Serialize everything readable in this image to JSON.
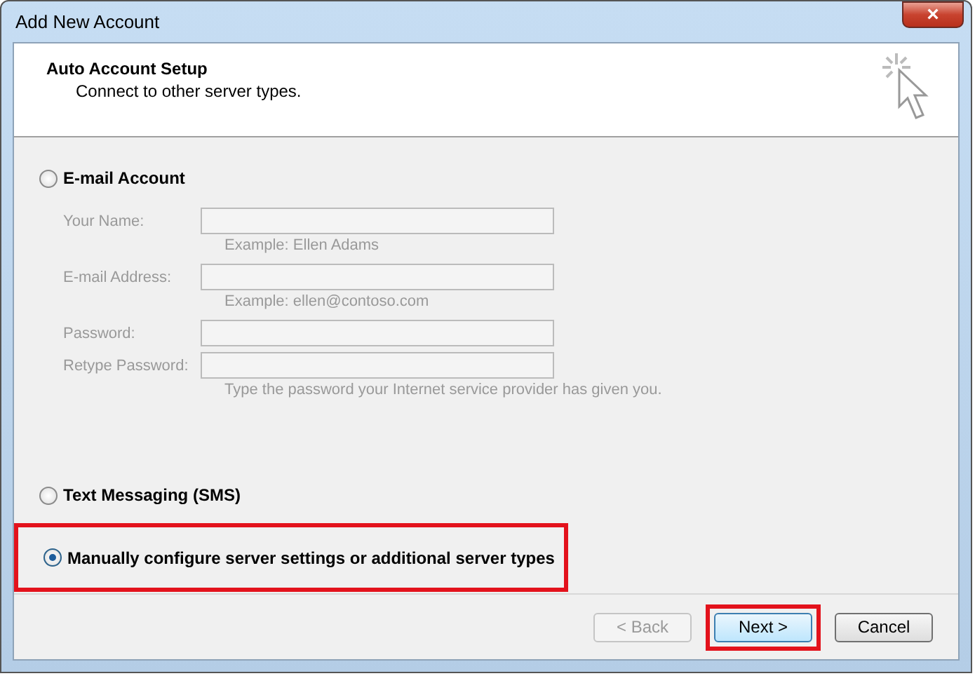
{
  "window": {
    "title": "Add New Account",
    "close": "×"
  },
  "header": {
    "title": "Auto Account Setup",
    "subtitle": "Connect to other server types."
  },
  "options": [
    {
      "label": "E-mail Account",
      "selected": false,
      "highlighted": false,
      "fields": [
        {
          "label": "Your Name:",
          "hint": "Example: Ellen Adams",
          "disabled": true
        },
        {
          "label": "E-mail Address:",
          "hint": "Example: ellen@contoso.com",
          "disabled": true
        },
        {
          "label": "Password:",
          "disabled": true
        },
        {
          "label": "Retype Password:",
          "hint": "Type the password your Internet service provider has given you.",
          "disabled": true
        }
      ]
    },
    {
      "label": "Text Messaging (SMS)",
      "selected": false,
      "highlighted": false
    },
    {
      "label": "Manually configure server settings or additional server types",
      "selected": true,
      "highlighted": true
    }
  ],
  "buttons": [
    {
      "label": "< Back",
      "disabled": true,
      "default": false,
      "highlighted": false
    },
    {
      "label": "Next >",
      "disabled": false,
      "default": true,
      "highlighted": true
    },
    {
      "label": "Cancel",
      "disabled": false,
      "default": false,
      "highlighted": false
    }
  ]
}
